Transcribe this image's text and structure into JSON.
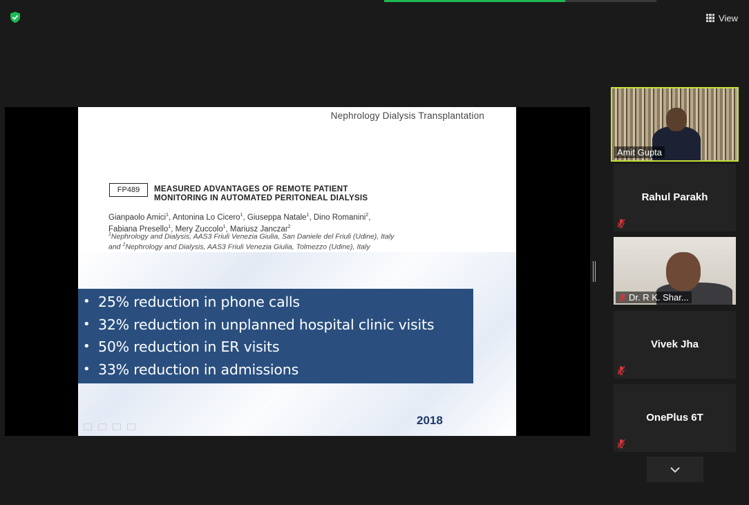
{
  "topbar": {
    "view_label": "View",
    "icons": [
      "shield-check-icon",
      "grid-icon"
    ],
    "accent": "#1db954"
  },
  "slide": {
    "journal": "Nephrology Dialysis Transplantation",
    "code": "FP489",
    "title_line1": "MEASURED ADVANTAGES OF REMOTE PATIENT",
    "title_line2": "MONITORING IN AUTOMATED PERITONEAL DIALYSIS",
    "authors_line1": [
      "Gianpaolo Amici",
      "1",
      ", Antonina Lo Cicero",
      "1",
      ", Giuseppa Natale",
      "1",
      ", Dino Romanini",
      "2",
      ","
    ],
    "authors_line2": [
      "Fabiana Presello",
      "1",
      ", Mery Zuccolo",
      "1",
      ", Mariusz Janczar",
      "2"
    ],
    "affil_line1": [
      "1",
      "Nephrology and Dialysis, AAS3 Friuli Venezia Giulia, San Daniele del Friuli (Udine), Italy"
    ],
    "affil_line2": [
      "and ",
      "2",
      "Nephrology and Dialysis, AAS3 Friuli Venezia Giulia, Tolmezzo (Udine), Italy"
    ],
    "bullets": [
      "25% reduction in phone calls",
      "32% reduction in unplanned hospital clinic visits",
      "50% reduction in ER visits",
      "33% reduction in admissions"
    ],
    "year": "2018",
    "box_color": "#2a4f7f"
  },
  "participants": [
    {
      "name": "Amit Gupta",
      "active": true
    },
    {
      "name": "Rahul Parakh",
      "muted": true
    },
    {
      "name": "Dr. R K. Shar...",
      "muted": true
    },
    {
      "name": "Vivek Jha",
      "muted": true
    },
    {
      "name": "OnePlus 6T",
      "muted": true
    }
  ],
  "active_speaker_border": "#c4e03a"
}
